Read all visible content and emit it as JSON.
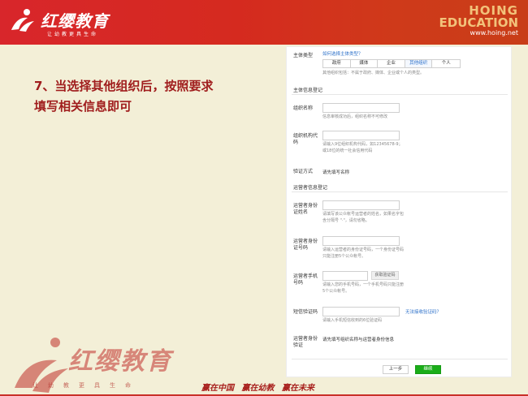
{
  "header": {
    "logo_text": "红缨教育",
    "logo_slogan": "让幼教更具生命",
    "brand_en_line1": "HOING",
    "brand_en_line2": "EDUCATION",
    "brand_url": "www.hoing.net"
  },
  "caption": {
    "line1": "7、当选择其他组织后，按照要求",
    "line2": "填写相关信息即可"
  },
  "form": {
    "subject_type_label": "主体类型",
    "subject_type_link": "如何选择主体类型？",
    "subject_types": [
      "政府",
      "媒体",
      "企业",
      "其他组织",
      "个人"
    ],
    "subject_type_active": "其他组织",
    "subject_type_hint": "其他组织包括：不属于政府、媒体、企业或个人的类型。",
    "section_subject": "主体信息登记",
    "org_name_label": "组织名称",
    "org_name_hint": "信息审核成功后，组织名称不可修改",
    "org_code_label": "组织机构代码",
    "org_code_hint1": "请输入9位组织机构代码，如12345678-9；",
    "org_code_hint2": "或18位的统一社会信用代码",
    "verify_method_label": "验证方式",
    "verify_method_value": "请先填写名称",
    "section_operator": "运营者信息登记",
    "op_name_label1": "运营者身份",
    "op_name_label2": "证姓名",
    "op_name_hint1": "请填写该公众帐号运营者的姓名，如果名字包",
    "op_name_hint2": "含分隔号 \"·\"，请勿省略。",
    "op_id_label1": "运营者身份",
    "op_id_label2": "证号码",
    "op_id_hint1": "请输入运营者的身份证号码，一个身份证号码",
    "op_id_hint2": "只能注册5个公众帐号。",
    "op_phone_label1": "运营者手机",
    "op_phone_label2": "号码",
    "op_phone_button": "获取验证码",
    "op_phone_hint1": "请输入您的手机号码，一个手机号码只能注册",
    "op_phone_hint2": "5个公众帐号。",
    "sms_label": "短信验证码",
    "sms_link": "无法接收验证码？",
    "sms_hint": "请输入手机短信收到的6位验证码",
    "op_verify_label1": "运营者身份",
    "op_verify_label2": "验证",
    "op_verify_value": "请先填写组织名称与运营者身份信息",
    "prev_button": "上一步",
    "next_button": "继续"
  },
  "footer": {
    "logo_text": "红缨教育",
    "slogan": "让幼教更具生命",
    "motto": "赢在中国 赢在幼教 赢在未来"
  },
  "colors": {
    "header_red": "#d8262b",
    "caption_red": "#a01d1d",
    "link_blue": "#2a6fc9",
    "primary_green": "#1aad19",
    "background": "#f3efd7"
  }
}
